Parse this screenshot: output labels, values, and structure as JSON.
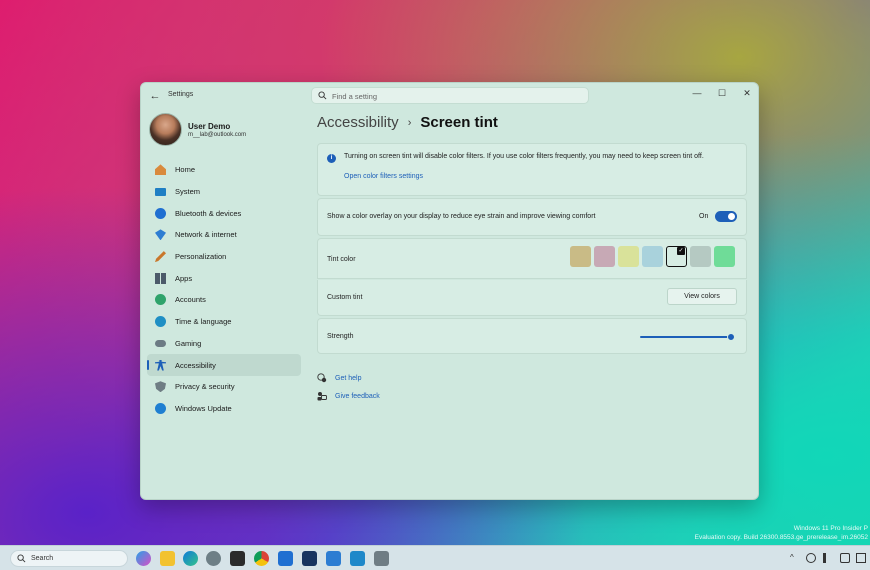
{
  "window": {
    "app_title": "Settings",
    "search_placeholder": "Find a setting",
    "controls": {
      "minimize": "—",
      "maximize": "☐",
      "close": "✕"
    }
  },
  "profile": {
    "name": "User Demo",
    "email": "m__lab@outlook.com"
  },
  "nav": {
    "items": [
      {
        "label": "Home",
        "icon": "home-icon"
      },
      {
        "label": "System",
        "icon": "system-icon"
      },
      {
        "label": "Bluetooth & devices",
        "icon": "bluetooth-icon"
      },
      {
        "label": "Network & internet",
        "icon": "wifi-icon"
      },
      {
        "label": "Personalization",
        "icon": "brush-icon"
      },
      {
        "label": "Apps",
        "icon": "apps-icon"
      },
      {
        "label": "Accounts",
        "icon": "accounts-icon"
      },
      {
        "label": "Time & language",
        "icon": "globe-icon"
      },
      {
        "label": "Gaming",
        "icon": "gamepad-icon"
      },
      {
        "label": "Accessibility",
        "icon": "accessibility-icon",
        "active": true
      },
      {
        "label": "Privacy & security",
        "icon": "shield-icon"
      },
      {
        "label": "Windows Update",
        "icon": "update-icon"
      }
    ]
  },
  "breadcrumb": {
    "parent": "Accessibility",
    "separator": "›",
    "current": "Screen tint"
  },
  "info": {
    "text": "Turning on screen tint will disable color filters. If you use color filters frequently, you may need to keep screen tint off.",
    "link": "Open color filters settings"
  },
  "overlay": {
    "label": "Show a color overlay on your display to reduce eye strain and improve viewing comfort",
    "state": "On",
    "enabled": true
  },
  "tint": {
    "label": "Tint color",
    "swatches": [
      "#c9bb86",
      "#c7a9b5",
      "#d9e29a",
      "#a9d2dc",
      "#d7ede4",
      "#b5c9c2",
      "#6fdc98"
    ],
    "selected_index": 4,
    "check": "✓"
  },
  "custom_tint": {
    "label": "Custom tint",
    "button": "View colors"
  },
  "strength": {
    "label": "Strength",
    "value_percent": 100
  },
  "help": {
    "get_help": "Get help",
    "give_feedback": "Give feedback"
  },
  "watermark": {
    "line1": "Windows 11 Pro Insider P",
    "line2": "Evaluation copy. Build 26300.8553.ge_prerelease_im.26052"
  },
  "taskbar": {
    "search_label": "Search"
  },
  "colors": {
    "accent": "#1d5fb8",
    "window_bg": "#cfe8de",
    "card_bg": "#d7ede4"
  }
}
